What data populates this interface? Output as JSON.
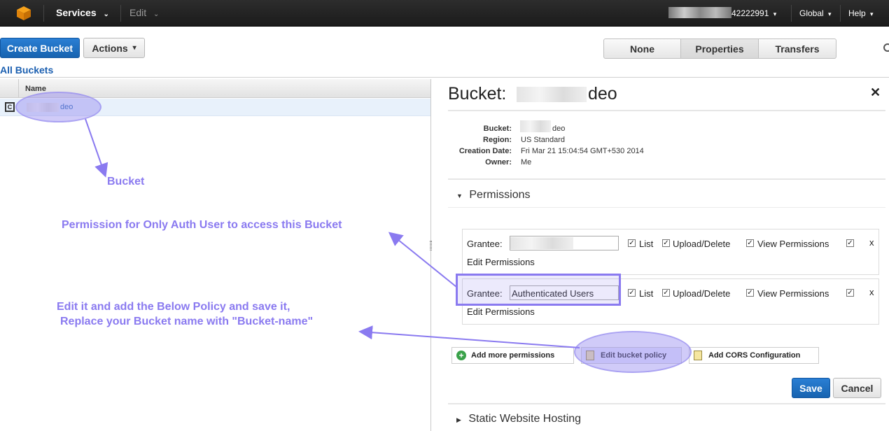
{
  "topbar": {
    "services_label": "Services",
    "edit_label": "Edit",
    "account_suffix": "42222991",
    "region_label": "Global",
    "help_label": "Help"
  },
  "toolbar": {
    "create_bucket": "Create Bucket",
    "actions": "Actions",
    "tabs": [
      "None",
      "Properties",
      "Transfers"
    ]
  },
  "breadcrumb": "All Buckets",
  "list": {
    "column_header": "Name",
    "rows": [
      {
        "name_suffix": "deo"
      }
    ]
  },
  "panel": {
    "title_prefix": "Bucket:",
    "title_suffix": "deo",
    "details": [
      {
        "label": "Bucket:",
        "value": "deo"
      },
      {
        "label": "Region:",
        "value": "US Standard"
      },
      {
        "label": "Creation Date:",
        "value": "Fri Mar 21 15:04:54 GMT+530 2014"
      },
      {
        "label": "Owner:",
        "value": "Me"
      }
    ],
    "permissions_heading": "Permissions",
    "grantees": [
      {
        "label": "Grantee:",
        "value": "",
        "list": "List",
        "upload": "Upload/Delete",
        "view": "View Permissions",
        "edit": "Edit Permissions"
      },
      {
        "label": "Grantee:",
        "value": "Authenticated Users",
        "list": "List",
        "upload": "Upload/Delete",
        "view": "View Permissions",
        "edit": "Edit Permissions"
      }
    ],
    "add_permissions": "Add more permissions",
    "edit_policy": "Edit bucket policy",
    "add_cors": "Add CORS Configuration",
    "save": "Save",
    "cancel": "Cancel",
    "static_hosting": "Static Website Hosting",
    "close_glyph": "✕",
    "remove_glyph": "x"
  },
  "annotations": {
    "bucket": "Bucket",
    "permission_note": "Permission for Only Auth User to access this Bucket",
    "edit_note_line1": "Edit it and add the Below Policy and save it,",
    "edit_note_line2": "Replace your Bucket name with \"Bucket-name\""
  },
  "colors": {
    "annotation": "#8a7af0",
    "primary_button": "#1763b0",
    "link": "#1b5fb0"
  }
}
